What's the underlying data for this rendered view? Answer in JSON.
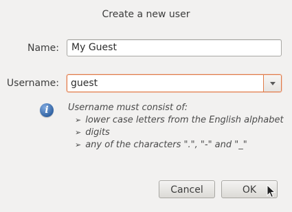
{
  "dialog": {
    "title": "Create a new user"
  },
  "form": {
    "name_label": "Name:",
    "name_value": "My Guest",
    "username_label": "Username:",
    "username_value": "guest"
  },
  "hint": {
    "icon": "info-icon",
    "heading": "Username must consist of:",
    "items": [
      "lower case letters from the English alphabet",
      "digits",
      "any of the characters \".\", \"-\" and \"_\""
    ],
    "bullet": "➢"
  },
  "buttons": {
    "cancel_label": "Cancel",
    "ok_label": "OK"
  },
  "colors": {
    "focus_border": "#e07a46",
    "info_blue": "#3465a4"
  }
}
